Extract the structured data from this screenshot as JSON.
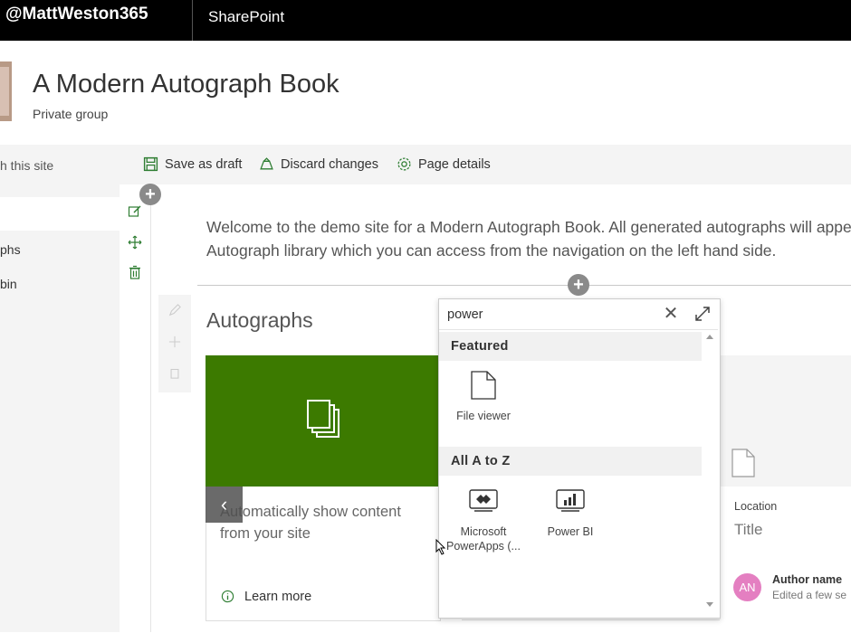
{
  "topbar": {
    "brand": "@MattWeston365",
    "app_name": "SharePoint"
  },
  "site": {
    "title": "A Modern Autograph Book",
    "subtitle": "Private group"
  },
  "leftnav": {
    "search_placeholder": "h this site",
    "items": [
      {
        "label": "phs"
      },
      {
        "label": "bin"
      }
    ]
  },
  "commandbar": {
    "save_label": "Save as draft",
    "discard_label": "Discard changes",
    "details_label": "Page details"
  },
  "canvas": {
    "welcome_text": "Welcome to the demo site for a Modern Autograph Book. All generated autographs will appea Autograph library which you can access from the navigation on the left hand side.",
    "autographs_title": "Autographs"
  },
  "card": {
    "text": "Automatically show content from your site",
    "learn_more": "Learn more",
    "accent_color": "#3c7a00"
  },
  "right_card": {
    "location": "Location",
    "title": "Title",
    "avatar_initials": "AN",
    "author": "Author name",
    "edited": "Edited a few se"
  },
  "toolbox": {
    "search_value": "power",
    "groups": [
      {
        "label": "Featured",
        "tools": [
          {
            "label": "File viewer",
            "icon": "file-icon"
          }
        ]
      },
      {
        "label": "All A to Z",
        "tools": [
          {
            "label": "Microsoft PowerApps (...",
            "icon": "powerapps-icon"
          },
          {
            "label": "Power BI",
            "icon": "powerbi-icon"
          }
        ]
      }
    ]
  },
  "icons": {
    "save": "save-icon",
    "discard": "discard-icon",
    "details": "gear-icon",
    "close": "close-icon",
    "expand": "expand-icon",
    "prev": "chevron-left-icon"
  }
}
